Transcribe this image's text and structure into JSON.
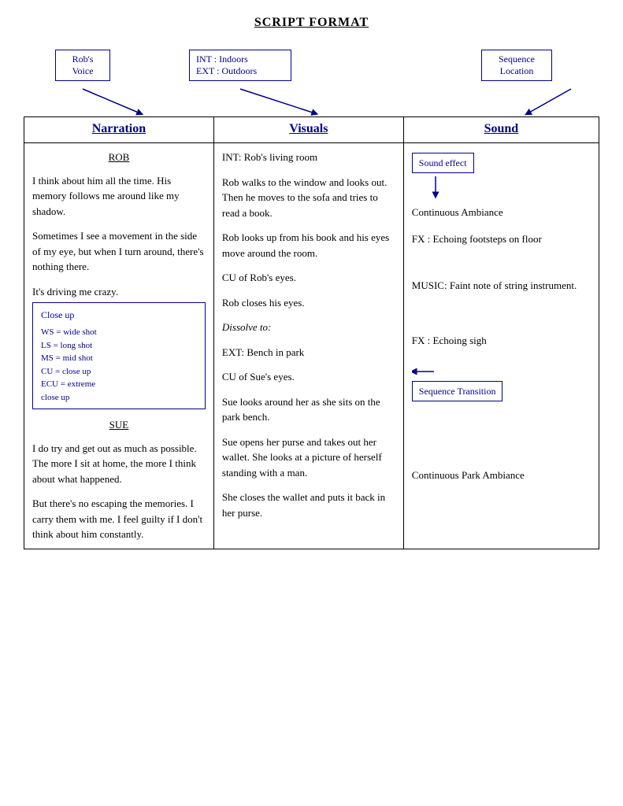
{
  "page": {
    "title": "Script Format"
  },
  "annotations": {
    "robs_voice": "Rob's\nVoice",
    "indoors_outdoors": "INT : Indoors\nEXT : Outdoors",
    "sequence_location": "Sequence\nLocation",
    "sound_effect": "Sound effect",
    "close_up_label": "Close up",
    "close_up_details": "WS = wide shot\nLS = long shot\nMS = mid shot\nCU = close up\nECU = extreme\nclose up",
    "sequence_transition": "Sequence Transition"
  },
  "headers": {
    "narration": "Narration",
    "visuals": "Visuals",
    "sound": "Sound"
  },
  "narration_col": {
    "speaker1": "ROB",
    "p1": "I think about him all the time. His memory follows me around like my shadow.",
    "p2": "Sometimes I see a movement in the side of my eye, but when I turn around, there's nothing there.",
    "p3": "It's driving me crazy.",
    "speaker2": "SUE",
    "p4": "I do try and get out as much as possible. The more I sit at home, the more I think about what happened.",
    "p5": "But there's no escaping the memories. I carry them with me. I feel guilty if I don't think about him constantly."
  },
  "visuals_col": {
    "v1": "INT: Rob's living room",
    "v2": "Rob walks to the window and looks out. Then he moves to the sofa and tries to read a book.",
    "v3": "Rob looks up from his book and his eyes move around the room.",
    "v4": "CU of Rob's eyes.",
    "v5": "Rob closes his eyes.",
    "v6": "Dissolve to:",
    "v7": "EXT: Bench in park",
    "v8": "CU of Sue's eyes.",
    "v9": "Sue looks around her as she sits on the park bench.",
    "v10": "Sue opens her purse and takes out her wallet. She looks at a picture of herself standing with a man.",
    "v11": "She closes the wallet and puts it back in her purse."
  },
  "sound_col": {
    "s1": "Continuous Ambiance",
    "s2": "FX : Echoing footsteps on floor",
    "s3": "MUSIC: Faint note of string instrument.",
    "s4": "FX : Echoing sigh",
    "s5": "Continuous Park Ambiance"
  }
}
